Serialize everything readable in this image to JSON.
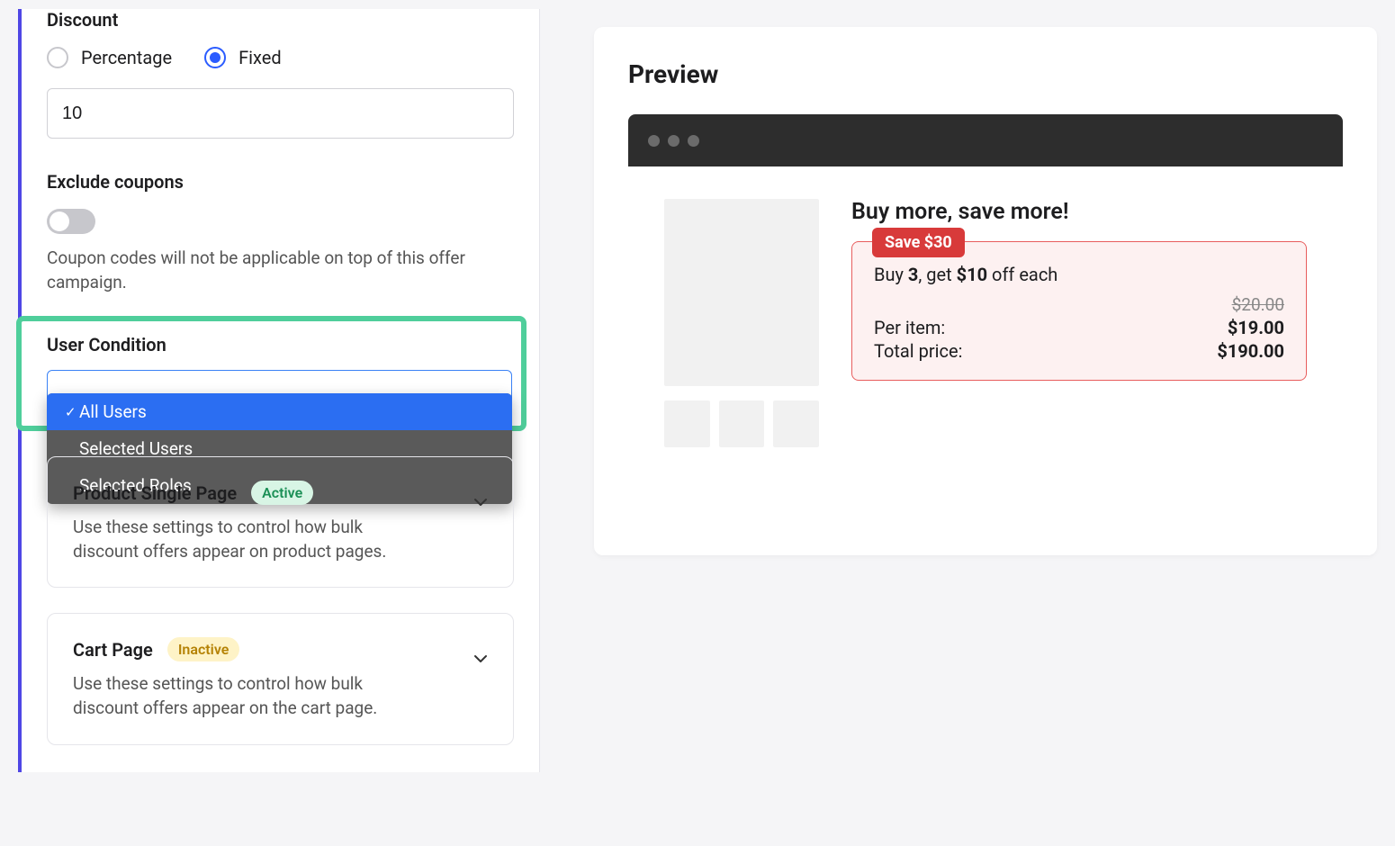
{
  "discount": {
    "label": "Discount",
    "options": {
      "percentage": "Percentage",
      "fixed": "Fixed"
    },
    "value": "10"
  },
  "exclude_coupons": {
    "label": "Exclude coupons",
    "help": "Coupon codes will not be applicable on top of this offer campaign."
  },
  "user_condition": {
    "label": "User Condition",
    "options": [
      "All Users",
      "Selected Users",
      "Selected Roles"
    ]
  },
  "cards": {
    "product_single": {
      "title": "Product Single Page",
      "badge": "Active",
      "desc": "Use these settings to control how bulk discount offers appear on product pages."
    },
    "cart": {
      "title": "Cart Page",
      "badge": "Inactive",
      "desc": "Use these settings to control how bulk discount offers appear on the cart page."
    }
  },
  "preview": {
    "title": "Preview",
    "product_title": "Buy more, save more!",
    "save_badge": "Save $30",
    "buy_prefix": "Buy ",
    "buy_qty": "3",
    "buy_mid": ", get ",
    "buy_amount": "$10",
    "buy_suffix": " off each",
    "old_price": "$20.00",
    "per_item_label": "Per item:",
    "per_item_value": "$19.00",
    "total_label": "Total price:",
    "total_value": "$190.00"
  }
}
